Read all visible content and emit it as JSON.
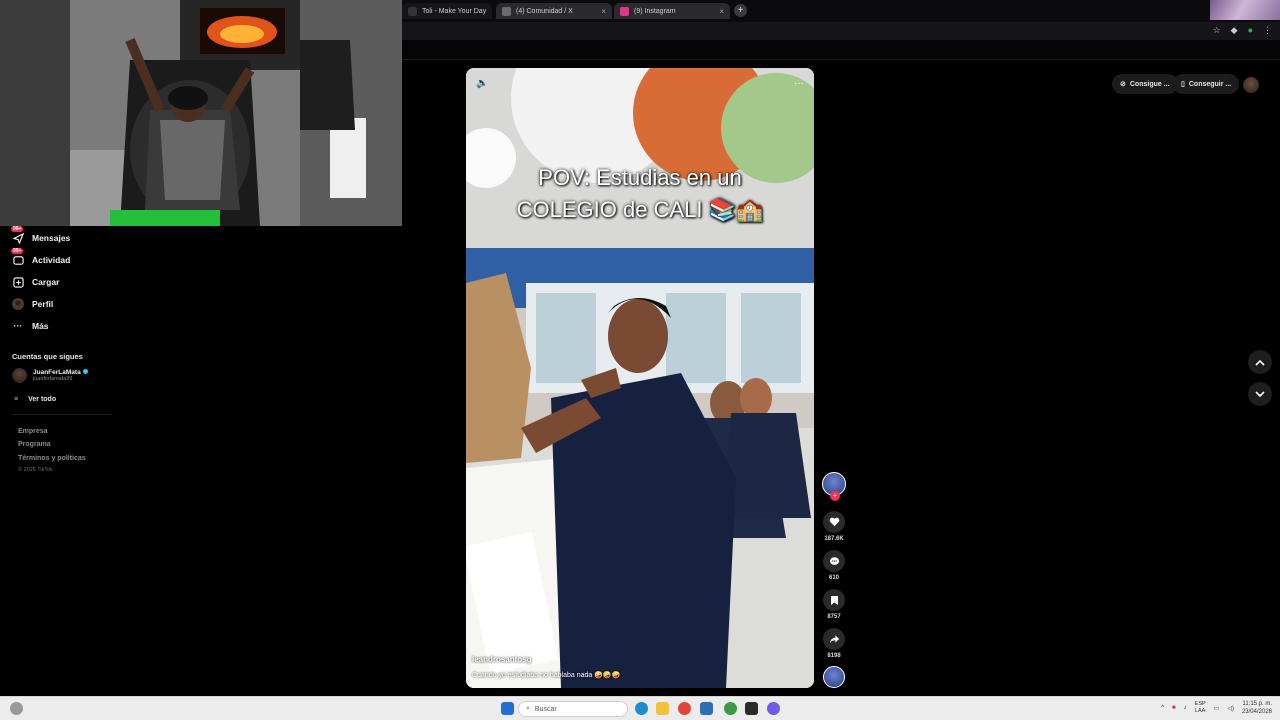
{
  "browser": {
    "tabs": [
      {
        "label": "Toli - Make Your Day",
        "favicon_color": "#2b2b2b"
      },
      {
        "label": "(4) Comunidad / X",
        "favicon_color": "#6b6b6b"
      },
      {
        "label": "(9) Instagram",
        "favicon_color": "#d8398d"
      }
    ],
    "new_tab_symbol": "+"
  },
  "sidebar": {
    "nav": [
      {
        "label": "Mensajes",
        "icon": "paper-plane-icon",
        "badge": "99+"
      },
      {
        "label": "Actividad",
        "icon": "inbox-icon",
        "badge": "99+"
      },
      {
        "label": "Cargar",
        "icon": "plus-square-icon"
      },
      {
        "label": "Perfil",
        "icon": "avatar-icon"
      },
      {
        "label": "Más",
        "icon": "ellipsis-icon"
      }
    ],
    "following_title": "Cuentas que sigues",
    "following": [
      {
        "name": "JuanFerLaMata",
        "handle": "juanferlamata99"
      }
    ],
    "see_all": "Ver todo",
    "footer_links": [
      "Empresa",
      "Programa",
      "Términos y políticas"
    ],
    "copyright": "© 2026 TikTok"
  },
  "video": {
    "caption_line1": "POV: Estudias en un",
    "caption_line2": "COLEGIO de CALI 📚🏫",
    "author": "leandrosantosg",
    "description": "Cuando yo estudiaba no hablaba nada 🤪🤪🤪"
  },
  "actions": {
    "likes": "187.6K",
    "comments": "610",
    "saves": "8757",
    "shares": "8198"
  },
  "top_right": {
    "get_coins": "Consigue ...",
    "get_app": "Conseguir ..."
  },
  "taskbar": {
    "search_placeholder": "Buscar",
    "lang_line1": "ESP",
    "lang_line2": "LAA",
    "time": "11:15 p. m.",
    "date": "23/04/2026"
  },
  "colors": {
    "accent": "#fe2c55",
    "verified": "#20d5ec"
  }
}
